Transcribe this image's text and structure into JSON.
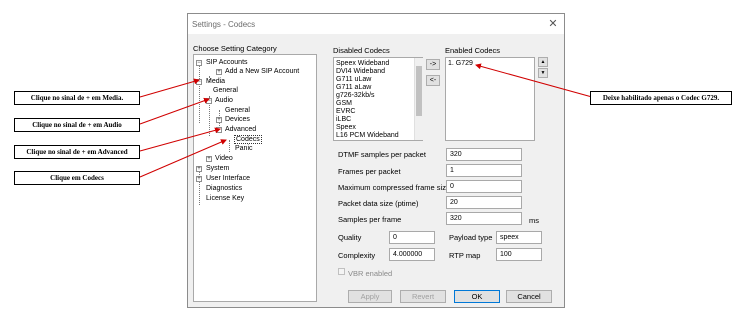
{
  "window": {
    "title": "Settings - Codecs",
    "close_glyph": "✕"
  },
  "sidebar": {
    "heading": "Choose Setting Category",
    "tree": {
      "sip_accounts": "SIP Accounts",
      "add_sip_account": "Add a New SIP Account",
      "media": "Media",
      "general": "General",
      "audio": "Audio",
      "audio_general": "General",
      "devices": "Devices",
      "advanced": "Advanced",
      "codecs": "Codecs",
      "panic": "Panic",
      "video": "Video",
      "system": "System",
      "user_interface": "User Interface",
      "diagnostics": "Diagnostics",
      "license_key": "License Key"
    }
  },
  "disabled_codecs": {
    "label": "Disabled Codecs",
    "items": [
      "Speex Wideband",
      "DVI4 Wideband",
      "G711 uLaw",
      "G711 aLaw",
      "g726-32kb/s",
      "GSM",
      "EVRC",
      "iLBC",
      "Speex",
      "L16 PCM Wideband"
    ]
  },
  "move_buttons": {
    "enable": "->",
    "disable": "<-"
  },
  "enabled_codecs": {
    "label": "Enabled Codecs",
    "items": [
      "1. G729"
    ],
    "up_glyph": "▲",
    "down_glyph": "▼"
  },
  "settings": {
    "dtmf": {
      "label": "DTMF samples per packet",
      "value": "320"
    },
    "frames": {
      "label": "Frames per packet",
      "value": "1"
    },
    "max_frame": {
      "label": "Maximum compressed frame size",
      "value": "0"
    },
    "ptime": {
      "label": "Packet data size (ptime)",
      "value": "20"
    },
    "samples": {
      "label": "Samples per frame",
      "value": "320",
      "unit": "ms"
    },
    "quality": {
      "label": "Quality",
      "value": "0"
    },
    "complexity": {
      "label": "Complexity",
      "value": "4.000000"
    },
    "payload_type": {
      "label": "Payload type",
      "value": "speex"
    },
    "rtp_map": {
      "label": "RTP map",
      "value": "100"
    },
    "vbr": {
      "label": "VBR enabled",
      "checked": false
    }
  },
  "footer": {
    "apply": "Apply",
    "revert": "Revert",
    "ok": "OK",
    "cancel": "Cancel"
  },
  "annotations": {
    "media": "Clique no sinal de + em Media.",
    "audio": "Clique no sinal de + em Audio",
    "advanced": "Clique no sinal de + em Advanced",
    "codecs": "Clique em Codecs",
    "g729": "Deixe habilitado apenas o Codec G729."
  },
  "colors": {
    "arrow": "#d00000",
    "accent": "#0078d7",
    "selected": "#cce8ff"
  }
}
